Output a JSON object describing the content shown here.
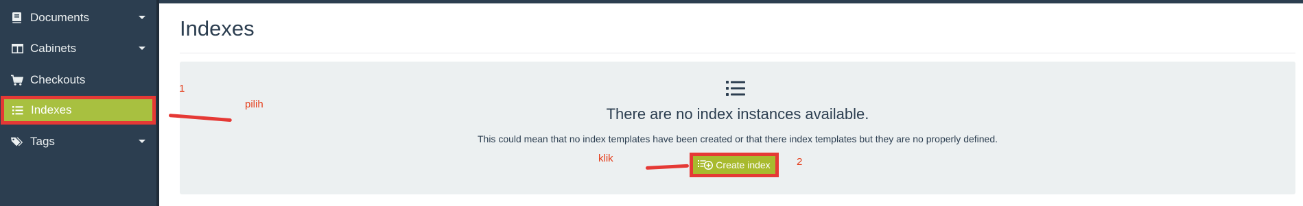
{
  "sidebar": {
    "items": [
      {
        "label": "Documents",
        "icon": "book-icon",
        "has_dropdown": true
      },
      {
        "label": "Cabinets",
        "icon": "columns-icon",
        "has_dropdown": true
      },
      {
        "label": "Checkouts",
        "icon": "cart-icon",
        "has_dropdown": false
      },
      {
        "label": "Indexes",
        "icon": "list-icon",
        "has_dropdown": false,
        "active": true
      },
      {
        "label": "Tags",
        "icon": "tags-icon",
        "has_dropdown": true
      }
    ]
  },
  "main": {
    "title": "Indexes",
    "empty_state": {
      "icon": "list-icon",
      "heading": "There are no index instances available.",
      "text": "This could mean that no index templates have been created or that there index templates but they are no properly defined.",
      "button_label": "Create index",
      "button_icon": "list-add-icon"
    }
  },
  "annotations": {
    "step1_number": "1",
    "step1_text": "pilih",
    "step2_number": "2",
    "step2_text": "klik"
  },
  "colors": {
    "sidebar_bg": "#2c3e50",
    "active_bg": "#a8c040",
    "button_bg": "#a8ba2e",
    "highlight_border": "#e53935",
    "annotation": "#e53d1a",
    "panel_bg": "#ecf0f1"
  }
}
